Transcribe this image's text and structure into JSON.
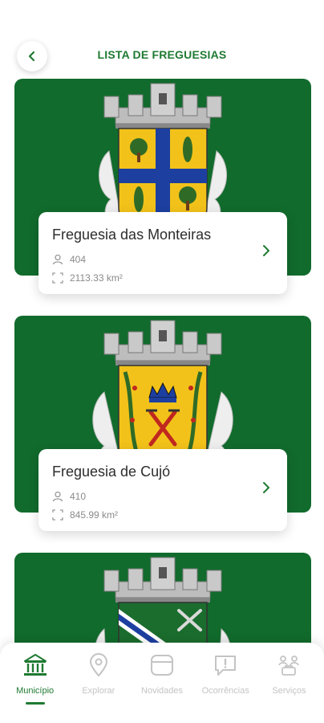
{
  "header": {
    "title": "LISTA DE FREGUESIAS",
    "back_icon": "chevron-left-icon"
  },
  "parishes": [
    {
      "name": "Freguesia das Monteiras",
      "population": "404",
      "area": "2113.33 km²"
    },
    {
      "name": "Freguesia de Cujó",
      "population": "410",
      "area": "845.99 km²"
    }
  ],
  "bottom_nav": {
    "items": [
      {
        "label": "Município",
        "icon": "building-icon",
        "active": true
      },
      {
        "label": "Explorar",
        "icon": "map-pin-icon",
        "active": false
      },
      {
        "label": "Novidades",
        "icon": "news-icon",
        "active": false
      },
      {
        "label": "Ocorrências",
        "icon": "alert-chat-icon",
        "active": false
      },
      {
        "label": "Serviços",
        "icon": "services-icon",
        "active": false
      }
    ]
  },
  "colors": {
    "brand_green": "#1f7a32",
    "card_green": "#116b2c",
    "inactive_gray": "#c4c4c4"
  }
}
